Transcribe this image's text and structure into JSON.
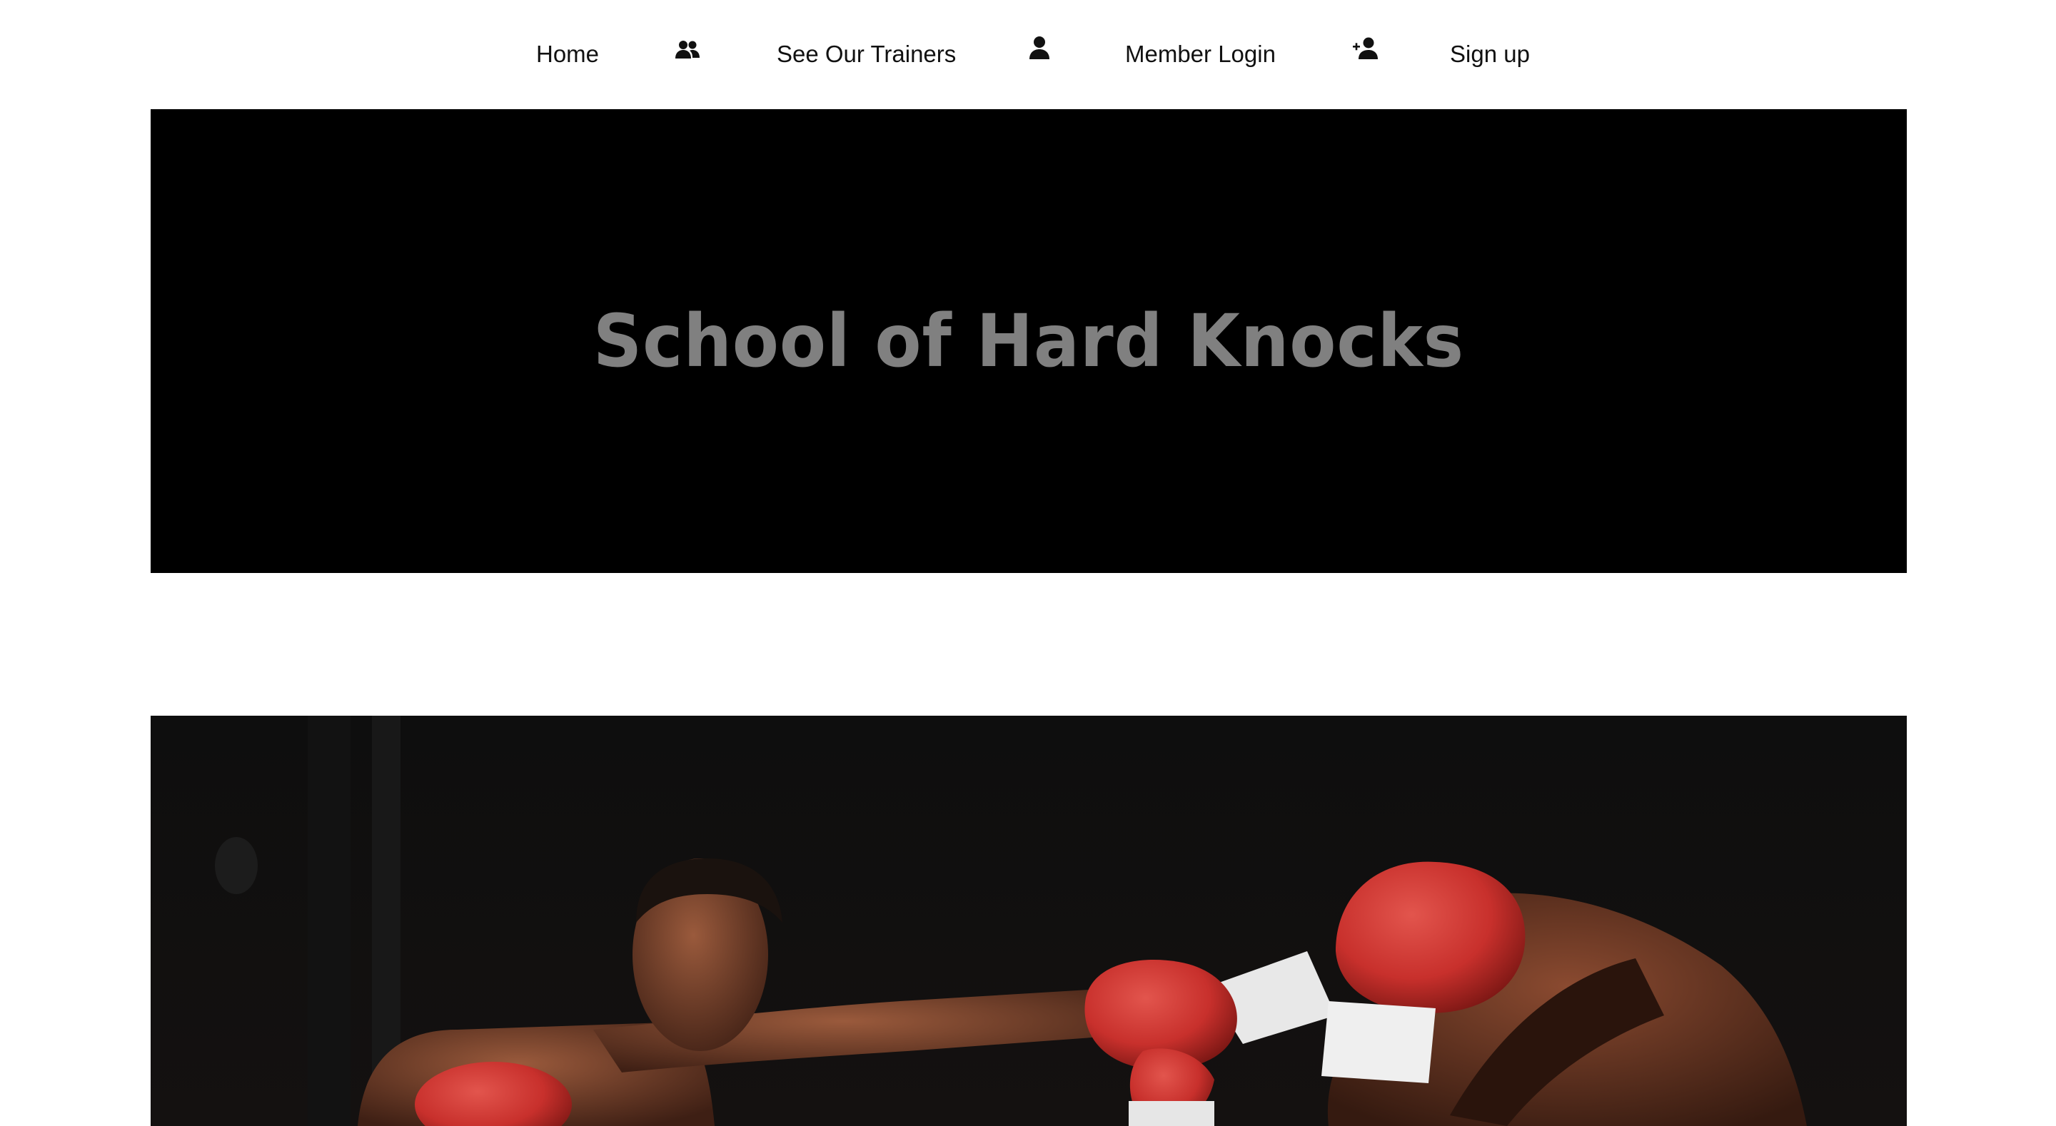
{
  "nav": {
    "items": [
      {
        "label": "Home",
        "icon": null
      },
      {
        "label": "See Our Trainers",
        "icon": "people-icon"
      },
      {
        "label": "Member Login",
        "icon": "person-icon"
      },
      {
        "label": "Sign up",
        "icon": "person-add-icon"
      }
    ]
  },
  "hero": {
    "title": "School of Hard Knocks"
  },
  "photo": {
    "subject": "boxing-match-photo"
  },
  "colors": {
    "hero_background": "#000000",
    "hero_title": "#808080",
    "nav_text": "#111111",
    "glove_red": "#c8302c"
  }
}
